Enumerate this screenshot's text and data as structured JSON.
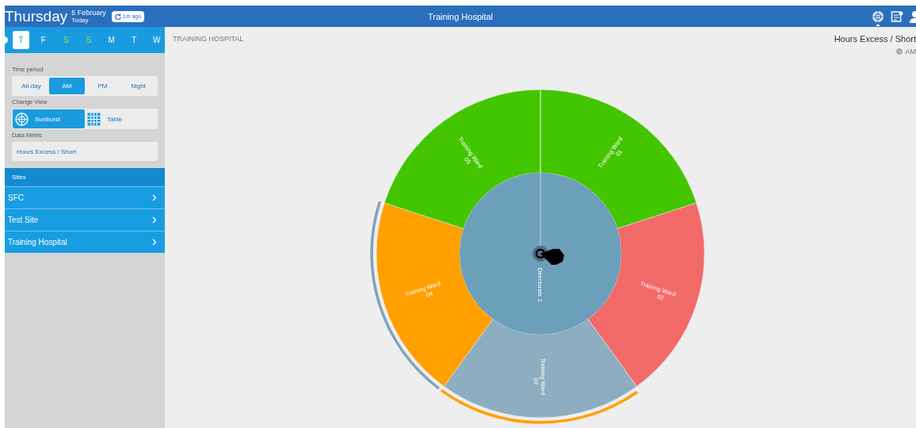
{
  "header": {
    "day": "Thursday",
    "date": "5 February",
    "relative": "Today",
    "refresh": "1m ago",
    "title": "Training Hospital",
    "icons": [
      {
        "kind": "sunburst",
        "selected": true
      },
      {
        "kind": "notes",
        "selected": false
      },
      {
        "kind": "user",
        "selected": false
      }
    ]
  },
  "days": [
    {
      "letter": "T",
      "selected": true,
      "weekend": false
    },
    {
      "letter": "F",
      "selected": false,
      "weekend": false
    },
    {
      "letter": "S",
      "selected": false,
      "weekend": true
    },
    {
      "letter": "S",
      "selected": false,
      "weekend": true
    },
    {
      "letter": "M",
      "selected": false,
      "weekend": false
    },
    {
      "letter": "T",
      "selected": false,
      "weekend": false
    },
    {
      "letter": "W",
      "selected": false,
      "weekend": false
    }
  ],
  "time_period": {
    "label": "Time period",
    "options": [
      {
        "label": "All-day",
        "selected": false
      },
      {
        "label": "AM",
        "selected": true
      },
      {
        "label": "PM",
        "selected": false
      },
      {
        "label": "Night",
        "selected": false
      }
    ]
  },
  "change_view": {
    "label": "Change View",
    "options": [
      {
        "label": "Sunburst",
        "kind": "sunburst",
        "selected": true
      },
      {
        "label": "Table",
        "kind": "table",
        "selected": false
      }
    ]
  },
  "data_metric": {
    "label": "Data Metric",
    "value": "Hours Excess / Short"
  },
  "sites": {
    "title": "Sites",
    "items": [
      {
        "label": "SFC"
      },
      {
        "label": "Test Site"
      },
      {
        "label": "Training Hospital"
      }
    ]
  },
  "main": {
    "breadcrumb": "TRAINING HOSPITAL",
    "legend": {
      "title": "Hours Excess / Short",
      "items": [
        {
          "label": "AM",
          "color": "#b0b0b0"
        }
      ]
    }
  },
  "sunburst": {
    "center": {
      "label": "Directorate 1",
      "color": "#6c9fba"
    },
    "segments": [
      {
        "name": "Training Ward",
        "code": "01",
        "color": "#43c500"
      },
      {
        "name": "Training Ward",
        "code": "02",
        "color": "#f26a68"
      },
      {
        "name": "Training Ward",
        "code": "03",
        "color": "#8caec0",
        "ring": {
          "color": "#ff9f00"
        }
      },
      {
        "name": "Training Ward",
        "code": "04",
        "color": "#ff9f00",
        "ring": {
          "color": "#7fa3b8"
        }
      },
      {
        "name": "Training Ward",
        "code": "05",
        "color": "#43c500"
      }
    ]
  }
}
